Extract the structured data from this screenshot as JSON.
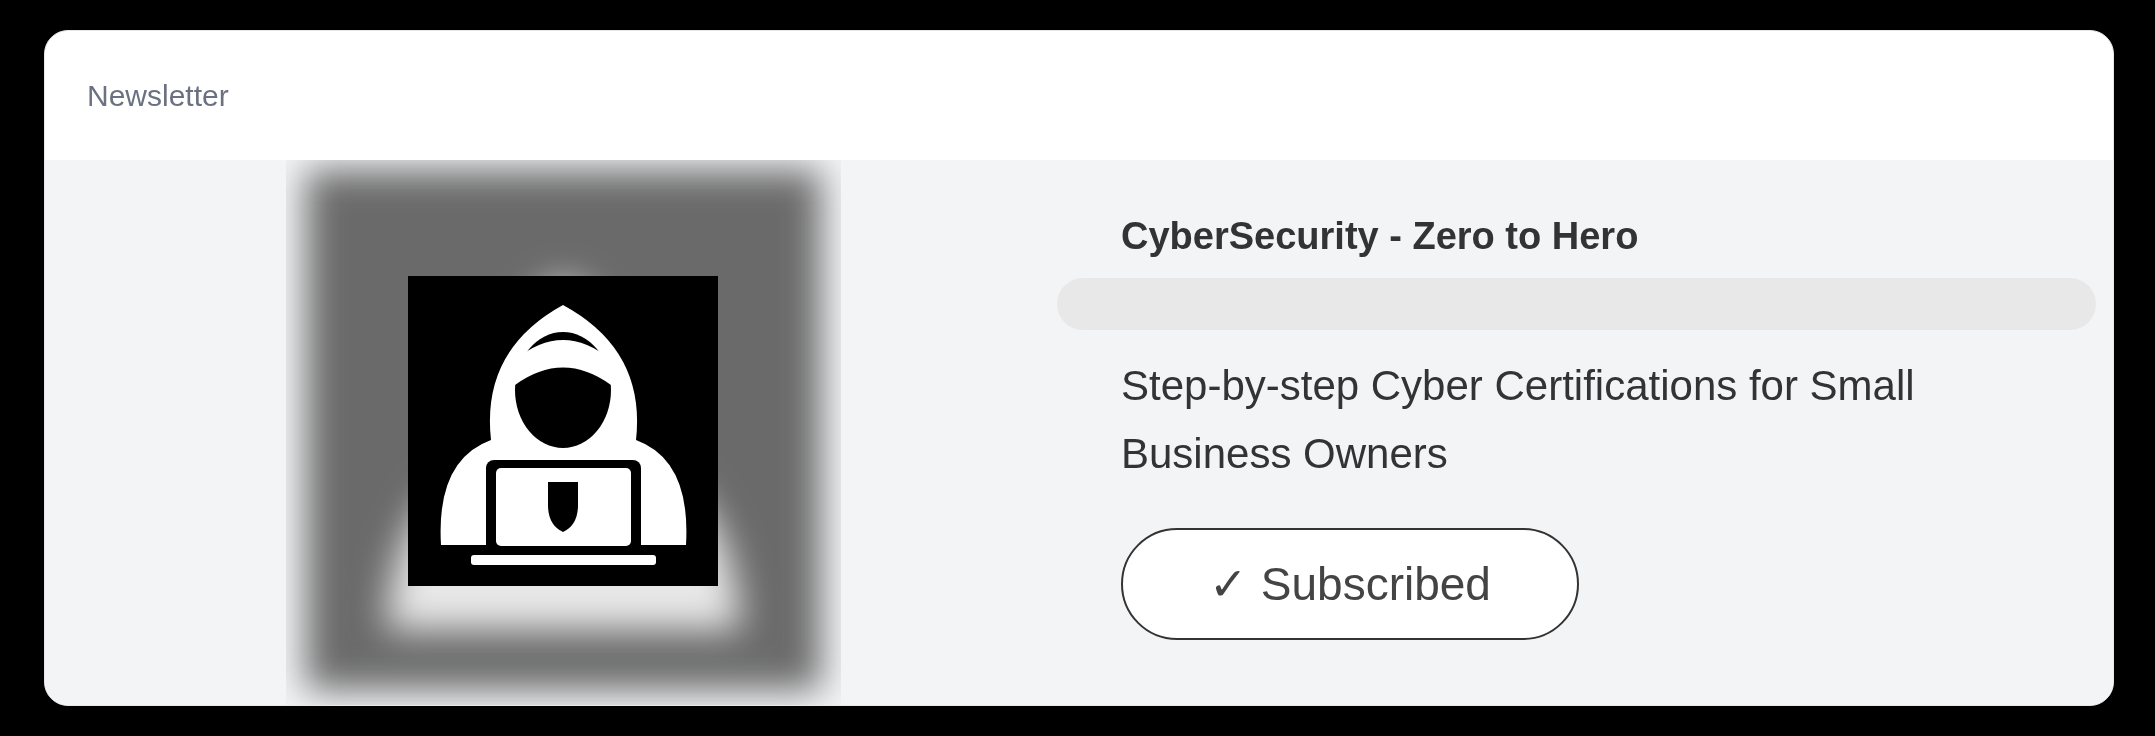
{
  "section": {
    "title": "Newsletter"
  },
  "newsletter": {
    "title": "CyberSecurity - Zero to Hero",
    "description": "Step-by-step Cyber Certifications for Small Business Owners",
    "subscribe_button": {
      "label": "✓ Subscribed",
      "subscribed": true
    }
  }
}
